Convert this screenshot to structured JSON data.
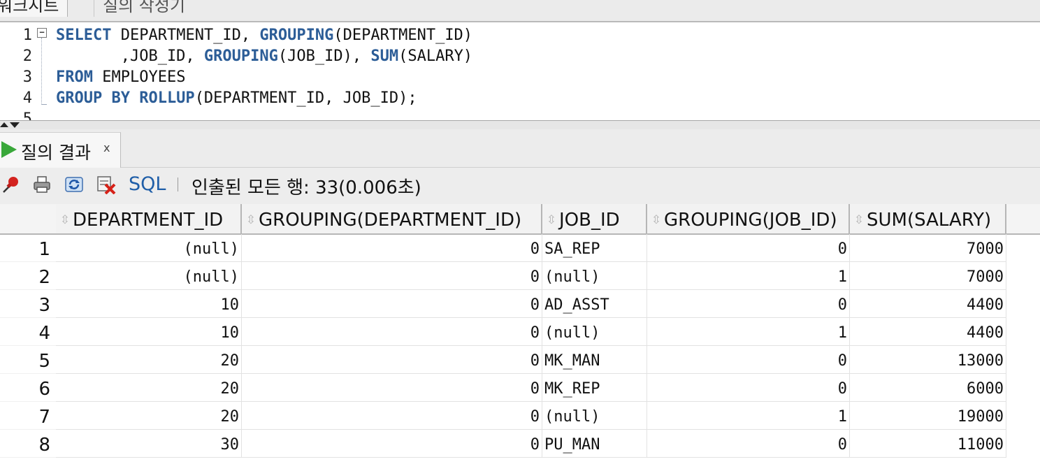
{
  "tabs": {
    "worksheet": "워크시트",
    "query_builder": "질의 작성기"
  },
  "editor": {
    "line_numbers": [
      "1",
      "2",
      "3",
      "4",
      "5"
    ],
    "lines": [
      [
        {
          "t": "SELECT",
          "kw": true
        },
        {
          "t": " DEPARTMENT_ID, "
        },
        {
          "t": "GROUPING",
          "kw": true
        },
        {
          "t": "(DEPARTMENT_ID)"
        }
      ],
      [
        {
          "t": "       ,JOB_ID, "
        },
        {
          "t": "GROUPING",
          "kw": true
        },
        {
          "t": "(JOB_ID), "
        },
        {
          "t": "SUM",
          "kw": true
        },
        {
          "t": "(SALARY)"
        }
      ],
      [
        {
          "t": "FROM",
          "kw": true
        },
        {
          "t": " EMPLOYEES"
        }
      ],
      [
        {
          "t": "GROUP BY ROLLUP",
          "kw": true
        },
        {
          "t": "(DEPARTMENT_ID, JOB_ID);"
        }
      ]
    ]
  },
  "result": {
    "tab_label": "질의 결과",
    "close_label": "x",
    "sql_label": "SQL",
    "status": "인출된 모든 행: 33(0.006초)"
  },
  "grid": {
    "columns": [
      {
        "label": "DEPARTMENT_ID",
        "align": "num"
      },
      {
        "label": "GROUPING(DEPARTMENT_ID)",
        "align": "num"
      },
      {
        "label": "JOB_ID",
        "align": "txt"
      },
      {
        "label": "GROUPING(JOB_ID)",
        "align": "num"
      },
      {
        "label": "SUM(SALARY)",
        "align": "num"
      }
    ],
    "rows": [
      {
        "num": "1",
        "cells": [
          "(null)",
          "0",
          "SA_REP",
          "0",
          "7000"
        ]
      },
      {
        "num": "2",
        "cells": [
          "(null)",
          "0",
          "(null)",
          "1",
          "7000"
        ]
      },
      {
        "num": "3",
        "cells": [
          "10",
          "0",
          "AD_ASST",
          "0",
          "4400"
        ]
      },
      {
        "num": "4",
        "cells": [
          "10",
          "0",
          "(null)",
          "1",
          "4400"
        ]
      },
      {
        "num": "5",
        "cells": [
          "20",
          "0",
          "MK_MAN",
          "0",
          "13000"
        ]
      },
      {
        "num": "6",
        "cells": [
          "20",
          "0",
          "MK_REP",
          "0",
          "6000"
        ]
      },
      {
        "num": "7",
        "cells": [
          "20",
          "0",
          "(null)",
          "1",
          "19000"
        ]
      },
      {
        "num": "8",
        "cells": [
          "30",
          "0",
          "PU_MAN",
          "0",
          "11000"
        ]
      }
    ]
  },
  "icons": [
    "pin-icon",
    "print-icon",
    "refresh-icon",
    "delete-icon",
    "play-icon",
    "sort-icon"
  ]
}
